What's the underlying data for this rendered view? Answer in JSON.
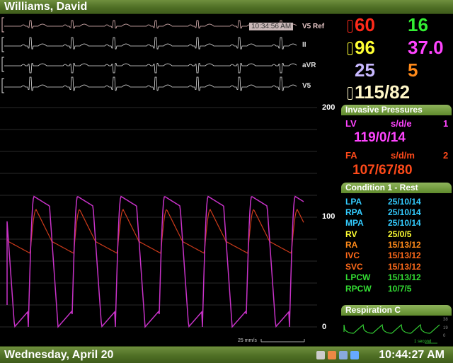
{
  "header": {
    "patient_name": "Williams, David"
  },
  "ecg": {
    "timestamp": "10:34:56 AM",
    "leads": [
      "V5 Ref",
      "II",
      "aVR",
      "V5"
    ]
  },
  "pressure_scale": {
    "max": "200",
    "mid": "100",
    "min": "0",
    "sweep": "25 mm/s"
  },
  "vitals": [
    {
      "value": "60",
      "color": "#ff2a1a"
    },
    {
      "value": "16",
      "color": "#33ee33"
    },
    {
      "value": "96",
      "color": "#ffff33"
    },
    {
      "value": "37.0",
      "color": "#ff44ff"
    },
    {
      "value": "25",
      "color": "#c8b8ff"
    },
    {
      "value": "5",
      "color": "#ff8a1a"
    },
    {
      "value": "115/82",
      "color": "#fff7c8"
    }
  ],
  "invasive": {
    "title": "Invasive Pressures",
    "channels": [
      {
        "name": "LV",
        "mode": "s/d/e",
        "index": "1",
        "value": "119/0/14",
        "color": "#ff44ff"
      },
      {
        "name": "FA",
        "mode": "s/d/m",
        "index": "2",
        "value": "107/67/80",
        "color": "#ff4a1a"
      }
    ]
  },
  "condition": {
    "title": "Condition 1 - Rest",
    "rows": [
      {
        "name": "LPA",
        "value": "25/10/14",
        "color": "#33ccff"
      },
      {
        "name": "RPA",
        "value": "25/10/14",
        "color": "#33ccff"
      },
      {
        "name": "MPA",
        "value": "25/10/14",
        "color": "#33ccff"
      },
      {
        "name": "RV",
        "value": "25/0/5",
        "color": "#ffff33"
      },
      {
        "name": "RA",
        "value": "15/13/12",
        "color": "#ff8a1a"
      },
      {
        "name": "IVC",
        "value": "15/13/12",
        "color": "#ff6a1a"
      },
      {
        "name": "SVC",
        "value": "15/13/12",
        "color": "#ff6a1a"
      },
      {
        "name": "LPCW",
        "value": "15/13/12",
        "color": "#33dd33"
      },
      {
        "name": "RPCW",
        "value": "10/7/5",
        "color": "#33dd33"
      }
    ]
  },
  "respiration": {
    "title": "Respiration C",
    "scale": [
      "38",
      "19",
      "0"
    ],
    "time_label": "1 second"
  },
  "footer": {
    "date": "Wednesday, April 20",
    "clock": "10:44:27 AM"
  }
}
